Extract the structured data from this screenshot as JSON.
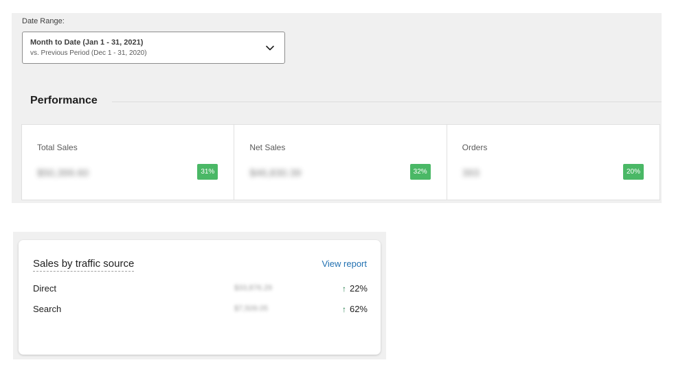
{
  "date_range": {
    "label": "Date Range:",
    "primary": "Month to Date (Jan 1 - 31, 2021)",
    "secondary": "vs. Previous Period (Dec 1 - 31, 2020)",
    "icon": "chevron-down-icon"
  },
  "performance": {
    "heading": "Performance",
    "tiles": [
      {
        "label": "Total Sales",
        "value": "$50,399.60",
        "change": "31%"
      },
      {
        "label": "Net Sales",
        "value": "$46,830.39",
        "change": "32%"
      },
      {
        "label": "Orders",
        "value": "393",
        "change": "20%"
      }
    ]
  },
  "traffic": {
    "title": "Sales by traffic source",
    "view_report": "View report",
    "rows": [
      {
        "source": "Direct",
        "value": "$33,876.29",
        "arrow": "↑",
        "change": "22%"
      },
      {
        "source": "Search",
        "value": "$7,509.05",
        "arrow": "↑",
        "change": "62%"
      }
    ]
  },
  "colors": {
    "badge_green": "#4ab866",
    "link_blue": "#2271b1",
    "arrow_green": "#1e7a46",
    "panel_bg": "#f0f0f0"
  }
}
